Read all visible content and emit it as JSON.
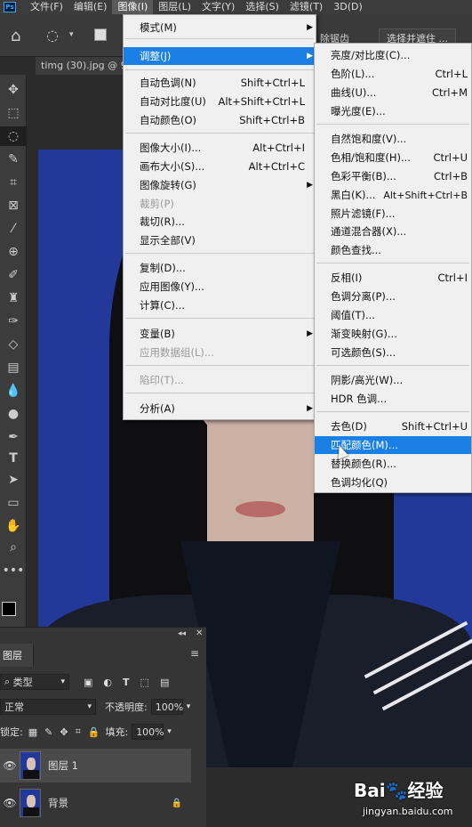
{
  "menubar": {
    "logo": "Ps",
    "items": [
      "文件(F)",
      "编辑(E)",
      "图像(I)",
      "图层(L)",
      "文字(Y)",
      "选择(S)",
      "滤镜(T)",
      "3D(D)"
    ]
  },
  "options_bar": {
    "feather_label": "除锯齿",
    "select_mask_label": "选择并遮住 ..."
  },
  "doc_tab": "timg (30).jpg @ 9",
  "image_menu": {
    "items": [
      {
        "label": "模式(M)",
        "shortcut": "",
        "submenu": true
      },
      {
        "label": "调整(J)",
        "shortcut": "",
        "submenu": true
      },
      {
        "label": "自动色调(N)",
        "shortcut": "Shift+Ctrl+L"
      },
      {
        "label": "自动对比度(U)",
        "shortcut": "Alt+Shift+Ctrl+L"
      },
      {
        "label": "自动颜色(O)",
        "shortcut": "Shift+Ctrl+B"
      },
      {
        "label": "图像大小(I)...",
        "shortcut": "Alt+Ctrl+I"
      },
      {
        "label": "画布大小(S)...",
        "shortcut": "Alt+Ctrl+C"
      },
      {
        "label": "图像旋转(G)",
        "shortcut": "",
        "submenu": true
      },
      {
        "label": "裁剪(P)",
        "shortcut": "",
        "disabled": true
      },
      {
        "label": "裁切(R)...",
        "shortcut": ""
      },
      {
        "label": "显示全部(V)",
        "shortcut": ""
      },
      {
        "label": "复制(D)...",
        "shortcut": ""
      },
      {
        "label": "应用图像(Y)...",
        "shortcut": ""
      },
      {
        "label": "计算(C)...",
        "shortcut": ""
      },
      {
        "label": "变量(B)",
        "shortcut": "",
        "submenu": true
      },
      {
        "label": "应用数据组(L)...",
        "shortcut": "",
        "disabled": true
      },
      {
        "label": "陷印(T)...",
        "shortcut": "",
        "disabled": true
      },
      {
        "label": "分析(A)",
        "shortcut": "",
        "submenu": true
      }
    ]
  },
  "adjust_menu": {
    "items": [
      {
        "label": "亮度/对比度(C)...",
        "shortcut": ""
      },
      {
        "label": "色阶(L)...",
        "shortcut": "Ctrl+L"
      },
      {
        "label": "曲线(U)...",
        "shortcut": "Ctrl+M"
      },
      {
        "label": "曝光度(E)...",
        "shortcut": ""
      },
      {
        "label": "自然饱和度(V)...",
        "shortcut": ""
      },
      {
        "label": "色相/饱和度(H)...",
        "shortcut": "Ctrl+U"
      },
      {
        "label": "色彩平衡(B)...",
        "shortcut": "Ctrl+B"
      },
      {
        "label": "黑白(K)...",
        "shortcut": "Alt+Shift+Ctrl+B"
      },
      {
        "label": "照片滤镜(F)...",
        "shortcut": ""
      },
      {
        "label": "通道混合器(X)...",
        "shortcut": ""
      },
      {
        "label": "颜色查找...",
        "shortcut": ""
      },
      {
        "label": "反相(I)",
        "shortcut": "Ctrl+I"
      },
      {
        "label": "色调分离(P)...",
        "shortcut": ""
      },
      {
        "label": "阈值(T)...",
        "shortcut": ""
      },
      {
        "label": "渐变映射(G)...",
        "shortcut": ""
      },
      {
        "label": "可选颜色(S)...",
        "shortcut": ""
      },
      {
        "label": "阴影/高光(W)...",
        "shortcut": ""
      },
      {
        "label": "HDR 色调...",
        "shortcut": ""
      },
      {
        "label": "去色(D)",
        "shortcut": "Shift+Ctrl+U"
      },
      {
        "label": "匹配颜色(M)...",
        "shortcut": ""
      },
      {
        "label": "替换颜色(R)...",
        "shortcut": ""
      },
      {
        "label": "色调均化(Q)",
        "shortcut": ""
      }
    ]
  },
  "layers_panel": {
    "tab": "图层",
    "filter_kind": "类型",
    "blend_mode": "正常",
    "opacity_label": "不透明度:",
    "opacity_value": "100%",
    "lock_label": "锁定:",
    "fill_label": "填充:",
    "fill_value": "100%",
    "layers": [
      {
        "name": "图层 1"
      },
      {
        "name": "背景"
      }
    ]
  },
  "watermark": {
    "logo": "Bai🐾经验",
    "url": "jingyan.baidu.com"
  }
}
